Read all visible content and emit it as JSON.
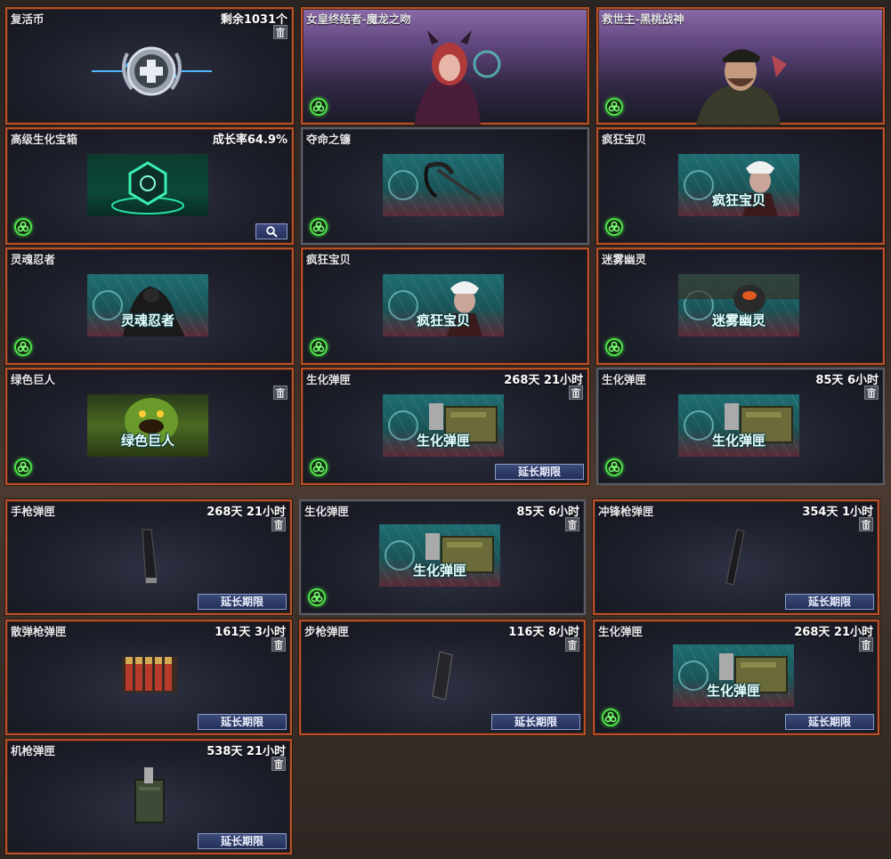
{
  "cards": [
    {
      "title": "复活币",
      "meta": "剩余1031个",
      "trash": true,
      "bio": false,
      "extend": false,
      "search": false
    },
    {
      "title": "女皇终结者-魔龙之吻",
      "meta": "",
      "trash": false,
      "bio": true,
      "extend": false,
      "search": false
    },
    {
      "title": "救世主-黑桃战神",
      "meta": "",
      "trash": false,
      "bio": true,
      "extend": false,
      "search": false
    },
    {
      "title": "高级生化宝箱",
      "meta": "成长率64.9%",
      "trash": false,
      "bio": true,
      "extend": false,
      "search": true
    },
    {
      "title": "夺命之镰",
      "meta": "",
      "trash": false,
      "bio": true,
      "extend": false,
      "search": false
    },
    {
      "title": "疯狂宝贝",
      "meta": "",
      "trash": false,
      "bio": true,
      "extend": false,
      "search": false,
      "art_label": "疯狂宝贝"
    },
    {
      "title": "灵魂忍者",
      "meta": "",
      "trash": false,
      "bio": true,
      "extend": false,
      "search": false,
      "art_label": "灵魂忍者"
    },
    {
      "title": "疯狂宝贝",
      "meta": "",
      "trash": false,
      "bio": true,
      "extend": false,
      "search": false,
      "art_label": "疯狂宝贝"
    },
    {
      "title": "迷雾幽灵",
      "meta": "",
      "trash": false,
      "bio": true,
      "extend": false,
      "search": false,
      "art_label": "迷雾幽灵"
    },
    {
      "title": "绿色巨人",
      "meta": "",
      "trash": true,
      "bio": true,
      "extend": false,
      "search": false,
      "art_label": "绿色巨人"
    },
    {
      "title": "生化弹匣",
      "meta": "268天 21小时",
      "trash": true,
      "bio": true,
      "extend": true,
      "search": false,
      "art_label": "生化弹匣"
    },
    {
      "title": "生化弹匣",
      "meta": "85天 6小时",
      "trash": true,
      "bio": true,
      "extend": false,
      "search": false,
      "art_label": "生化弹匣"
    },
    {
      "title": "手枪弹匣",
      "meta": "268天 21小时",
      "trash": true,
      "bio": false,
      "extend": true,
      "search": false
    },
    {
      "title": "生化弹匣",
      "meta": "85天 6小时",
      "trash": true,
      "bio": true,
      "extend": false,
      "search": false,
      "art_label": "生化弹匣"
    },
    {
      "title": "冲锋枪弹匣",
      "meta": "354天 1小时",
      "trash": true,
      "bio": false,
      "extend": true,
      "search": false
    },
    {
      "title": "散弹枪弹匣",
      "meta": "161天 3小时",
      "trash": true,
      "bio": false,
      "extend": true,
      "search": false
    },
    {
      "title": "步枪弹匣",
      "meta": "116天 8小时",
      "trash": true,
      "bio": false,
      "extend": true,
      "search": false
    },
    {
      "title": "生化弹匣",
      "meta": "268天 21小时",
      "trash": true,
      "bio": true,
      "extend": true,
      "search": false,
      "art_label": "生化弹匣"
    },
    {
      "title": "机枪弹匣",
      "meta": "538天 21小时",
      "trash": true,
      "bio": false,
      "extend": true,
      "search": false
    }
  ],
  "labels": {
    "extend": "延长期限"
  },
  "icons": {
    "trash": "trash-icon",
    "search": "magnifier-icon",
    "bio": "biohazard-icon"
  },
  "colors": {
    "border_active": "#b8512a",
    "border_inactive": "#5b5e68",
    "button_bg": "#2f3c6b",
    "bio_green": "#4ee34a"
  }
}
